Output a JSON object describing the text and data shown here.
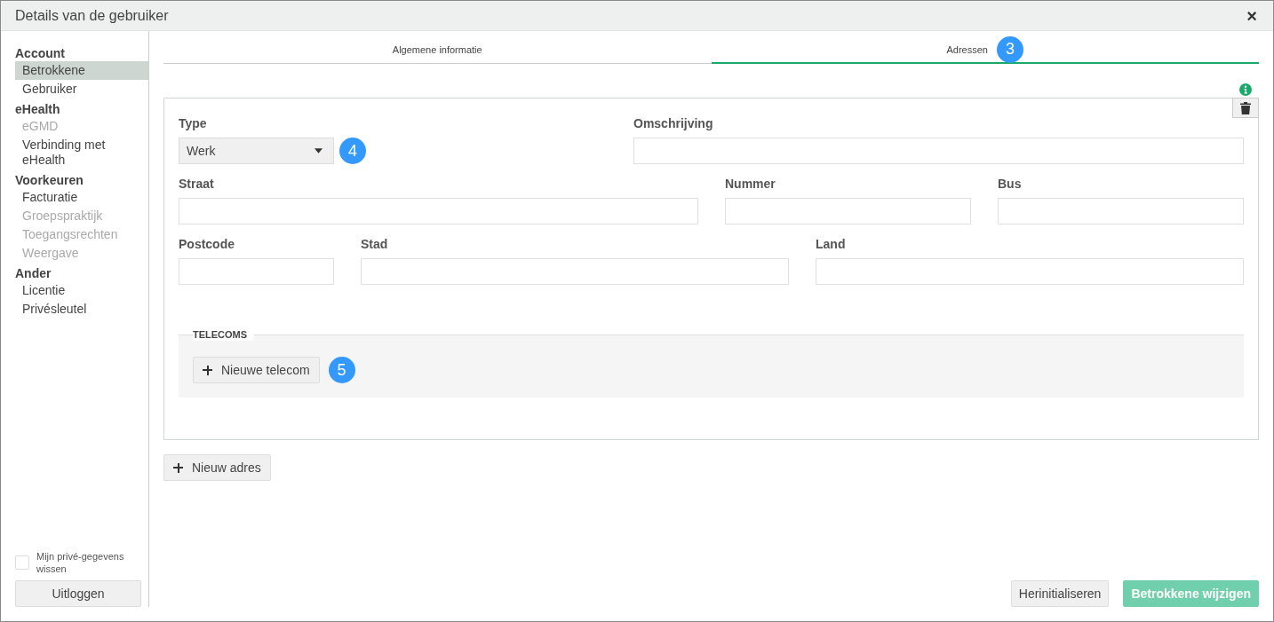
{
  "window": {
    "title": "Details van de gebruiker",
    "close": "×"
  },
  "sidebar": {
    "groups": [
      {
        "title": "Account",
        "items": [
          {
            "label": "Betrokkene",
            "selected": true,
            "disabled": false
          },
          {
            "label": "Gebruiker",
            "selected": false,
            "disabled": false
          }
        ]
      },
      {
        "title": "eHealth",
        "items": [
          {
            "label": "eGMD",
            "selected": false,
            "disabled": true
          },
          {
            "label": "Verbinding met eHealth",
            "selected": false,
            "disabled": false
          }
        ]
      },
      {
        "title": "Voorkeuren",
        "items": [
          {
            "label": "Facturatie",
            "selected": false,
            "disabled": false
          },
          {
            "label": "Groepspraktijk",
            "selected": false,
            "disabled": true
          },
          {
            "label": "Toegangsrechten",
            "selected": false,
            "disabled": true
          },
          {
            "label": "Weergave",
            "selected": false,
            "disabled": true
          }
        ]
      },
      {
        "title": "Ander",
        "items": [
          {
            "label": "Licentie",
            "selected": false,
            "disabled": false
          },
          {
            "label": "Privésleutel",
            "selected": false,
            "disabled": false
          }
        ]
      }
    ],
    "checkbox": {
      "label": "Mijn privé-gegevens wissen",
      "checked": false
    },
    "logout_button": "Uitloggen"
  },
  "tabs": [
    {
      "label": "Algemene informatie",
      "selected": false
    },
    {
      "label": "Adressen",
      "selected": true,
      "badge": "3"
    }
  ],
  "address": {
    "rows": [
      [
        {
          "label": "Type",
          "kind": "select",
          "value": "Werk",
          "badge": "4"
        },
        {
          "label": "Omschrijving",
          "kind": "text"
        }
      ],
      [
        {
          "label": "Straat",
          "kind": "text"
        },
        {
          "label": "Nummer",
          "kind": "text"
        },
        {
          "label": "Bus",
          "kind": "text"
        }
      ],
      [
        {
          "label": "Postcode",
          "kind": "text"
        },
        {
          "label": "Stad",
          "kind": "text"
        },
        {
          "label": "Land",
          "kind": "text"
        }
      ]
    ],
    "telecoms": {
      "title": "TELECOMS",
      "button": "Nieuwe telecom",
      "badge": "5"
    }
  },
  "new_address_button": "Nieuw adres",
  "footer": {
    "reset_button": "Herinitialiseren",
    "submit_button": {
      "label": "Betrokkene wijzigen",
      "disabled": true
    }
  }
}
